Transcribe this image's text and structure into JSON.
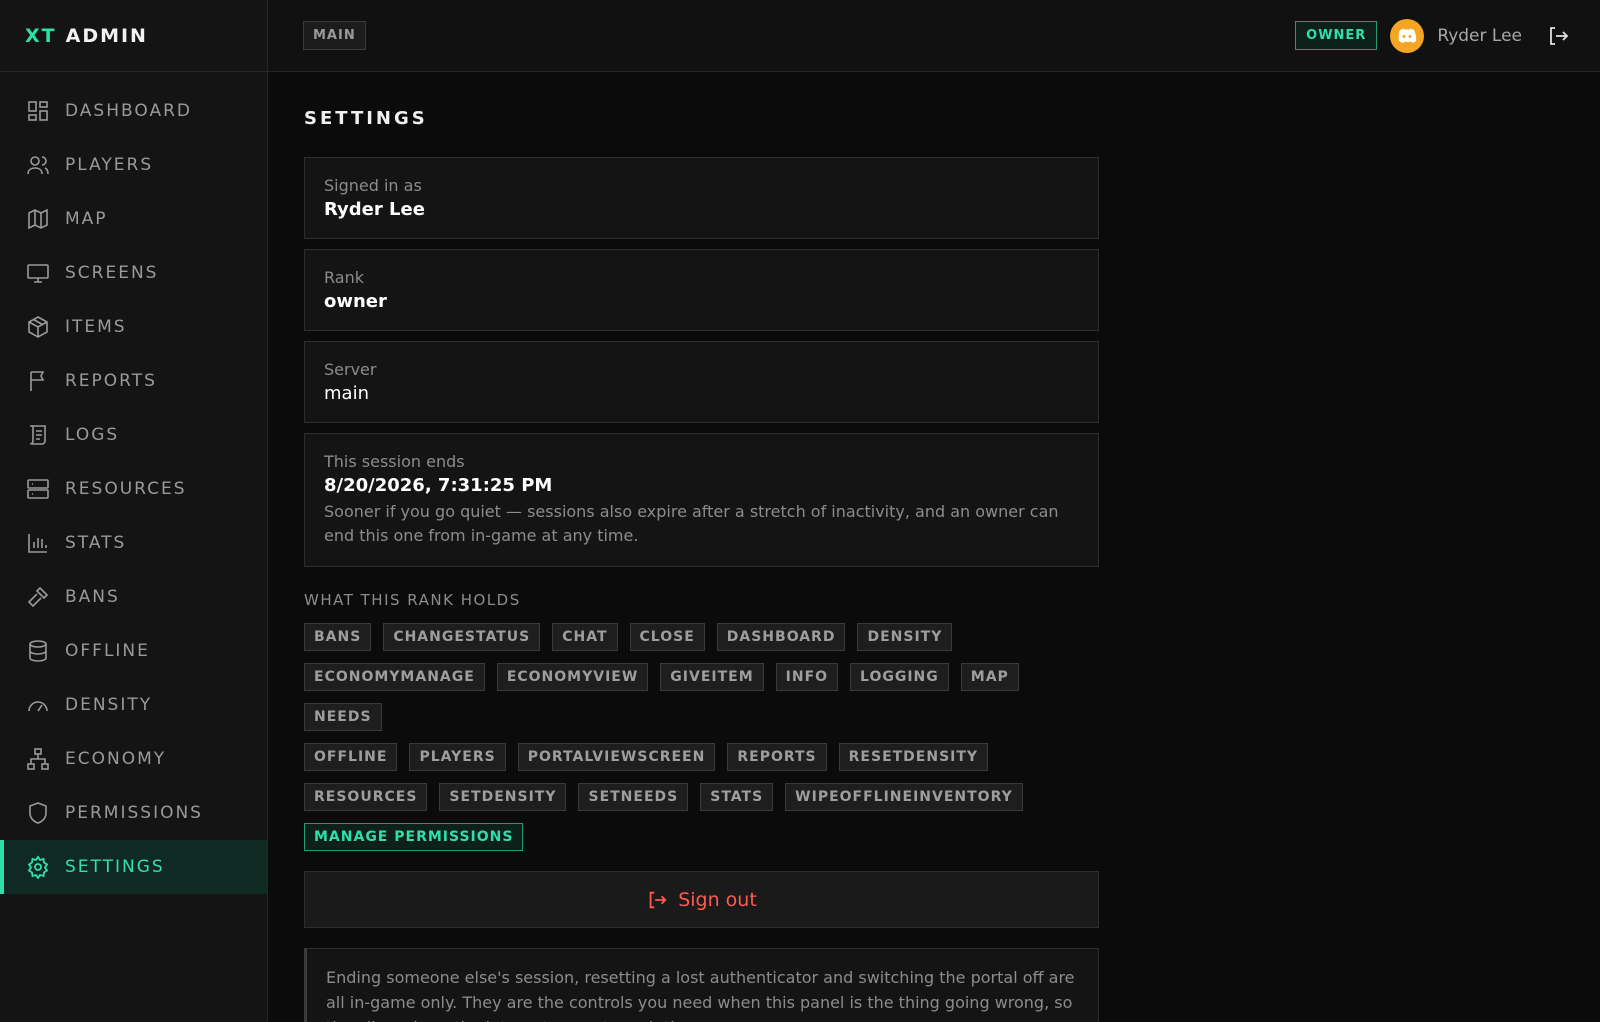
{
  "brand": {
    "accent": "XT",
    "name": "ADMIN"
  },
  "sidebar": {
    "items": [
      {
        "label": "DASHBOARD",
        "icon": "dashboard-icon"
      },
      {
        "label": "PLAYERS",
        "icon": "users-icon"
      },
      {
        "label": "MAP",
        "icon": "map-icon"
      },
      {
        "label": "SCREENS",
        "icon": "monitor-icon"
      },
      {
        "label": "ITEMS",
        "icon": "box-icon"
      },
      {
        "label": "REPORTS",
        "icon": "flag-icon"
      },
      {
        "label": "LOGS",
        "icon": "scroll-icon"
      },
      {
        "label": "RESOURCES",
        "icon": "server-icon"
      },
      {
        "label": "STATS",
        "icon": "bar-chart-icon"
      },
      {
        "label": "BANS",
        "icon": "gavel-icon"
      },
      {
        "label": "OFFLINE",
        "icon": "database-icon"
      },
      {
        "label": "DENSITY",
        "icon": "gauge-icon"
      },
      {
        "label": "ECONOMY",
        "icon": "network-icon"
      },
      {
        "label": "PERMISSIONS",
        "icon": "shield-icon"
      },
      {
        "label": "SETTINGS",
        "icon": "gear-icon",
        "active": true
      }
    ]
  },
  "topbar": {
    "breadcrumb": "MAIN",
    "role_badge": "OWNER",
    "username": "Ryder Lee"
  },
  "main": {
    "title": "SETTINGS",
    "signed_in": {
      "label": "Signed in as",
      "value": "Ryder Lee"
    },
    "rank": {
      "label": "Rank",
      "value": "owner"
    },
    "server": {
      "label": "Server",
      "value": "main"
    },
    "session": {
      "label": "This session ends",
      "value": "8/20/2026, 7:31:25 PM",
      "note": "Sooner if you go quiet — sessions also expire after a stretch of inactivity, and an owner can end this one from in-game at any time."
    },
    "rank_holds_label": "WHAT THIS RANK HOLDS",
    "permissions": [
      "BANS",
      "CHANGESTATUS",
      "CHAT",
      "CLOSE",
      "DASHBOARD",
      "DENSITY",
      "ECONOMYMANAGE",
      "ECONOMYVIEW",
      "GIVEITEM",
      "INFO",
      "LOGGING",
      "MAP",
      "NEEDS",
      "OFFLINE",
      "PLAYERS",
      "PORTALVIEWSCREEN",
      "REPORTS",
      "RESETDENSITY",
      "RESOURCES",
      "SETDENSITY",
      "SETNEEDS",
      "STATS",
      "WIPEOFFLINEINVENTORY"
    ],
    "manage_permissions": "MANAGE PERMISSIONS",
    "sign_out": "Sign out",
    "notice": "Ending someone else's session, resetting a lost authenticator and switching the portal off are all in-game only. They are the controls you need when this panel is the thing going wrong, so they live where the internet cannot reach them."
  },
  "colors": {
    "accent": "#2ee0a8",
    "danger": "#ff5a50",
    "avatar": "#f5a524"
  }
}
